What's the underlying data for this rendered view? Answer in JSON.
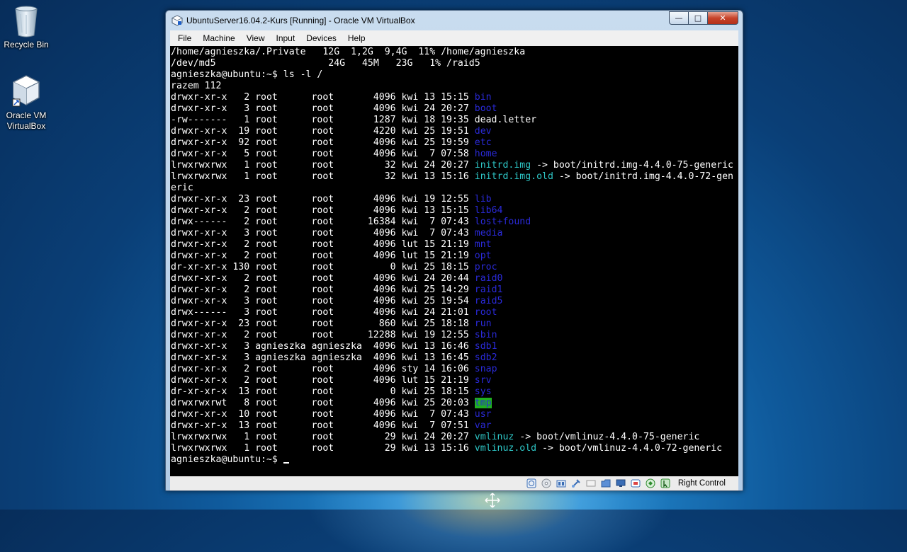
{
  "desktop": {
    "icons": [
      {
        "label": "Recycle Bin"
      },
      {
        "label": "Oracle VM VirtualBox"
      }
    ]
  },
  "window": {
    "title": "UbuntuServer16.04.2-Kurs [Running] - Oracle VM VirtualBox",
    "menu": [
      "File",
      "Machine",
      "View",
      "Input",
      "Devices",
      "Help"
    ],
    "status_host_key": "Right Control"
  },
  "terminal": {
    "lines": [
      [
        {
          "t": "/home/agnieszka/.Private   12G  1,2G  9,4G  11% /home/agnieszka"
        }
      ],
      [
        {
          "t": "/dev/md5                    24G   45M   23G   1% /raid5"
        }
      ],
      [
        {
          "t": "agnieszka@ubuntu:~$ ls -l /"
        }
      ],
      [
        {
          "t": "razem 112"
        }
      ],
      [
        {
          "t": "drwxr-xr-x   2 root      root       4096 kwi 13 15:15 "
        },
        {
          "t": "bin",
          "c": "dir"
        }
      ],
      [
        {
          "t": "drwxr-xr-x   3 root      root       4096 kwi 24 20:27 "
        },
        {
          "t": "boot",
          "c": "dir"
        }
      ],
      [
        {
          "t": "-rw-------   1 root      root       1287 kwi 18 19:35 dead.letter"
        }
      ],
      [
        {
          "t": "drwxr-xr-x  19 root      root       4220 kwi 25 19:51 "
        },
        {
          "t": "dev",
          "c": "dir"
        }
      ],
      [
        {
          "t": "drwxr-xr-x  92 root      root       4096 kwi 25 19:59 "
        },
        {
          "t": "etc",
          "c": "dir"
        }
      ],
      [
        {
          "t": "drwxr-xr-x   5 root      root       4096 kwi  7 07:58 "
        },
        {
          "t": "home",
          "c": "dir"
        }
      ],
      [
        {
          "t": "lrwxrwxrwx   1 root      root         32 kwi 24 20:27 "
        },
        {
          "t": "initrd.img",
          "c": "link"
        },
        {
          "t": " -> boot/initrd.img-4.4.0-75-generic"
        }
      ],
      [
        {
          "t": "lrwxrwxrwx   1 root      root         32 kwi 13 15:16 "
        },
        {
          "t": "initrd.img.old",
          "c": "link"
        },
        {
          "t": " -> boot/initrd.img-4.4.0-72-gen"
        }
      ],
      [
        {
          "t": "eric"
        }
      ],
      [
        {
          "t": "drwxr-xr-x  23 root      root       4096 kwi 19 12:55 "
        },
        {
          "t": "lib",
          "c": "dir"
        }
      ],
      [
        {
          "t": "drwxr-xr-x   2 root      root       4096 kwi 13 15:15 "
        },
        {
          "t": "lib64",
          "c": "dir"
        }
      ],
      [
        {
          "t": "drwx------   2 root      root      16384 kwi  7 07:43 "
        },
        {
          "t": "lost+found",
          "c": "dir"
        }
      ],
      [
        {
          "t": "drwxr-xr-x   3 root      root       4096 kwi  7 07:43 "
        },
        {
          "t": "media",
          "c": "dir"
        }
      ],
      [
        {
          "t": "drwxr-xr-x   2 root      root       4096 lut 15 21:19 "
        },
        {
          "t": "mnt",
          "c": "dir"
        }
      ],
      [
        {
          "t": "drwxr-xr-x   2 root      root       4096 lut 15 21:19 "
        },
        {
          "t": "opt",
          "c": "dir"
        }
      ],
      [
        {
          "t": "dr-xr-xr-x 130 root      root          0 kwi 25 18:15 "
        },
        {
          "t": "proc",
          "c": "dir"
        }
      ],
      [
        {
          "t": "drwxr-xr-x   2 root      root       4096 kwi 24 20:44 "
        },
        {
          "t": "raid0",
          "c": "dir"
        }
      ],
      [
        {
          "t": "drwxr-xr-x   2 root      root       4096 kwi 25 14:29 "
        },
        {
          "t": "raid1",
          "c": "dir"
        }
      ],
      [
        {
          "t": "drwxr-xr-x   3 root      root       4096 kwi 25 19:54 "
        },
        {
          "t": "raid5",
          "c": "dir"
        }
      ],
      [
        {
          "t": "drwx------   3 root      root       4096 kwi 24 21:01 "
        },
        {
          "t": "root",
          "c": "dir"
        }
      ],
      [
        {
          "t": "drwxr-xr-x  23 root      root        860 kwi 25 18:18 "
        },
        {
          "t": "run",
          "c": "dir"
        }
      ],
      [
        {
          "t": "drwxr-xr-x   2 root      root      12288 kwi 19 12:55 "
        },
        {
          "t": "sbin",
          "c": "dir"
        }
      ],
      [
        {
          "t": "drwxr-xr-x   3 agnieszka agnieszka  4096 kwi 13 16:46 "
        },
        {
          "t": "sdb1",
          "c": "dir"
        }
      ],
      [
        {
          "t": "drwxr-xr-x   3 agnieszka agnieszka  4096 kwi 13 16:45 "
        },
        {
          "t": "sdb2",
          "c": "dir"
        }
      ],
      [
        {
          "t": "drwxr-xr-x   2 root      root       4096 sty 14 16:06 "
        },
        {
          "t": "snap",
          "c": "dir"
        }
      ],
      [
        {
          "t": "drwxr-xr-x   2 root      root       4096 lut 15 21:19 "
        },
        {
          "t": "srv",
          "c": "dir"
        }
      ],
      [
        {
          "t": "dr-xr-xr-x  13 root      root          0 kwi 25 18:15 "
        },
        {
          "t": "sys",
          "c": "dir"
        }
      ],
      [
        {
          "t": "drwxrwxrwt   8 root      root       4096 kwi 25 20:03 "
        },
        {
          "t": "tmp",
          "c": "tmp"
        }
      ],
      [
        {
          "t": "drwxr-xr-x  10 root      root       4096 kwi  7 07:43 "
        },
        {
          "t": "usr",
          "c": "dir"
        }
      ],
      [
        {
          "t": "drwxr-xr-x  13 root      root       4096 kwi  7 07:51 "
        },
        {
          "t": "var",
          "c": "dir"
        }
      ],
      [
        {
          "t": "lrwxrwxrwx   1 root      root         29 kwi 24 20:27 "
        },
        {
          "t": "vmlinuz",
          "c": "link"
        },
        {
          "t": " -> boot/vmlinuz-4.4.0-75-generic"
        }
      ],
      [
        {
          "t": "lrwxrwxrwx   1 root      root         29 kwi 13 15:16 "
        },
        {
          "t": "vmlinuz.old",
          "c": "link"
        },
        {
          "t": " -> boot/vmlinuz-4.4.0-72-generic"
        }
      ],
      [
        {
          "t": "agnieszka@ubuntu:~$ "
        }
      ]
    ]
  },
  "colors": {
    "terminal_bg": "#000000",
    "terminal_fg": "#ffffff",
    "dir": "#2a2ad8",
    "link": "#2ec7c7",
    "sticky_bg": "#20b020"
  }
}
